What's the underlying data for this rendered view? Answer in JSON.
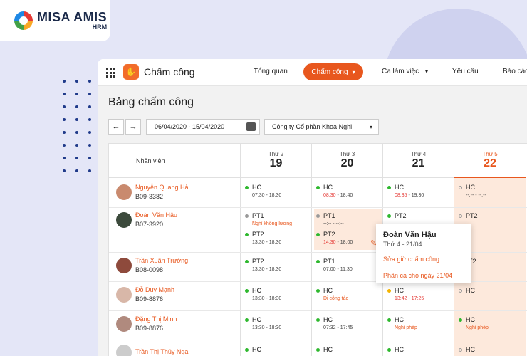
{
  "brand": {
    "name": "MISA AMIS",
    "sub": "HRM"
  },
  "app": {
    "title": "Chấm công"
  },
  "nav": {
    "overview": "Tổng quan",
    "timekeeping": "Chấm công",
    "shifts": "Ca làm việc",
    "requests": "Yêu cầu",
    "reports": "Báo cáo"
  },
  "page": {
    "title": "Bảng chấm công",
    "date_range": "06/04/2020 - 15/04/2020",
    "company": "Công ty Cổ phần Khoa Nghi"
  },
  "table": {
    "employee_header": "Nhân viên",
    "days": [
      {
        "name": "Thứ 2",
        "num": "19"
      },
      {
        "name": "Thứ 3",
        "num": "20"
      },
      {
        "name": "Thứ 4",
        "num": "21"
      },
      {
        "name": "Thứ 5",
        "num": "22"
      }
    ],
    "employees": [
      {
        "name": "Nguyễn Quang Hải",
        "code": "B09-3382"
      },
      {
        "name": "Đoàn Văn Hậu",
        "code": "B07-3920"
      },
      {
        "name": "Trần Xuân Trường",
        "code": "B08-0098"
      },
      {
        "name": "Đỗ Duy Mạnh",
        "code": "B09-8876"
      },
      {
        "name": "Đặng Thị Minh",
        "code": "B09-8876"
      },
      {
        "name": "Trần Thị Thúy Nga",
        "code": ""
      }
    ],
    "cells": {
      "r0c0": {
        "shift": "HC",
        "time": "07:30 - 18:30"
      },
      "r0c1": {
        "shift": "HC",
        "time_late": "08:30",
        "time_rest": " - 18:40"
      },
      "r0c2": {
        "shift": "HC",
        "time_late": "08:35",
        "time_rest": " - 19:30"
      },
      "r0c3": {
        "shift": "HC",
        "time": "--:-- - --:--"
      },
      "r1c0": {
        "shift1": "PT1",
        "note1": "Nghỉ không lương",
        "shift2": "PT2",
        "time2": "13:30 - 18:30"
      },
      "r1c1": {
        "shift1": "PT1",
        "time1": "--:-- - --:--",
        "shift2": "PT2",
        "time_late2": "14:30",
        "time_rest2": " - 18:00"
      },
      "r1c2": {
        "shift1": "PT2"
      },
      "r1c3": {
        "shift1": "PT2"
      },
      "r2c0": {
        "shift": "PT2",
        "time": "13:30 - 18:30"
      },
      "r2c1": {
        "shift": "PT1",
        "time": "07:00 - 11:30"
      },
      "r2c3": {
        "shift": "T2"
      },
      "r3c0": {
        "shift": "HC",
        "time": "13:30 - 18:30"
      },
      "r3c1": {
        "shift": "HC",
        "note": "Đi công tác"
      },
      "r3c2": {
        "shift": "HC",
        "time_late": "13:42",
        "time_rest": " - 17:25"
      },
      "r3c3": {
        "shift": "HC"
      },
      "r4c0": {
        "shift": "HC",
        "time": "13:30 - 18:30"
      },
      "r4c1": {
        "shift": "HC",
        "time": "07:32 - 17:45"
      },
      "r4c2": {
        "shift": "HC",
        "note": "Nghỉ phép"
      },
      "r4c3": {
        "shift": "HC",
        "note": "Nghỉ phép"
      },
      "r5c0": {
        "shift": "HC"
      },
      "r5c1": {
        "shift": "HC"
      },
      "r5c2": {
        "shift": "HC"
      },
      "r5c3": {
        "shift": "HC"
      }
    }
  },
  "popup": {
    "name": "Đoàn Văn Hậu",
    "date": "Thứ 4 - 21/04",
    "link1": "Sửa giờ chấm công",
    "link2": "Phân ca cho ngày 21/04"
  },
  "colors": {
    "accent": "#e8571e",
    "ok": "#2eb82e",
    "late": "#e53935",
    "warn": "#f4b400"
  }
}
